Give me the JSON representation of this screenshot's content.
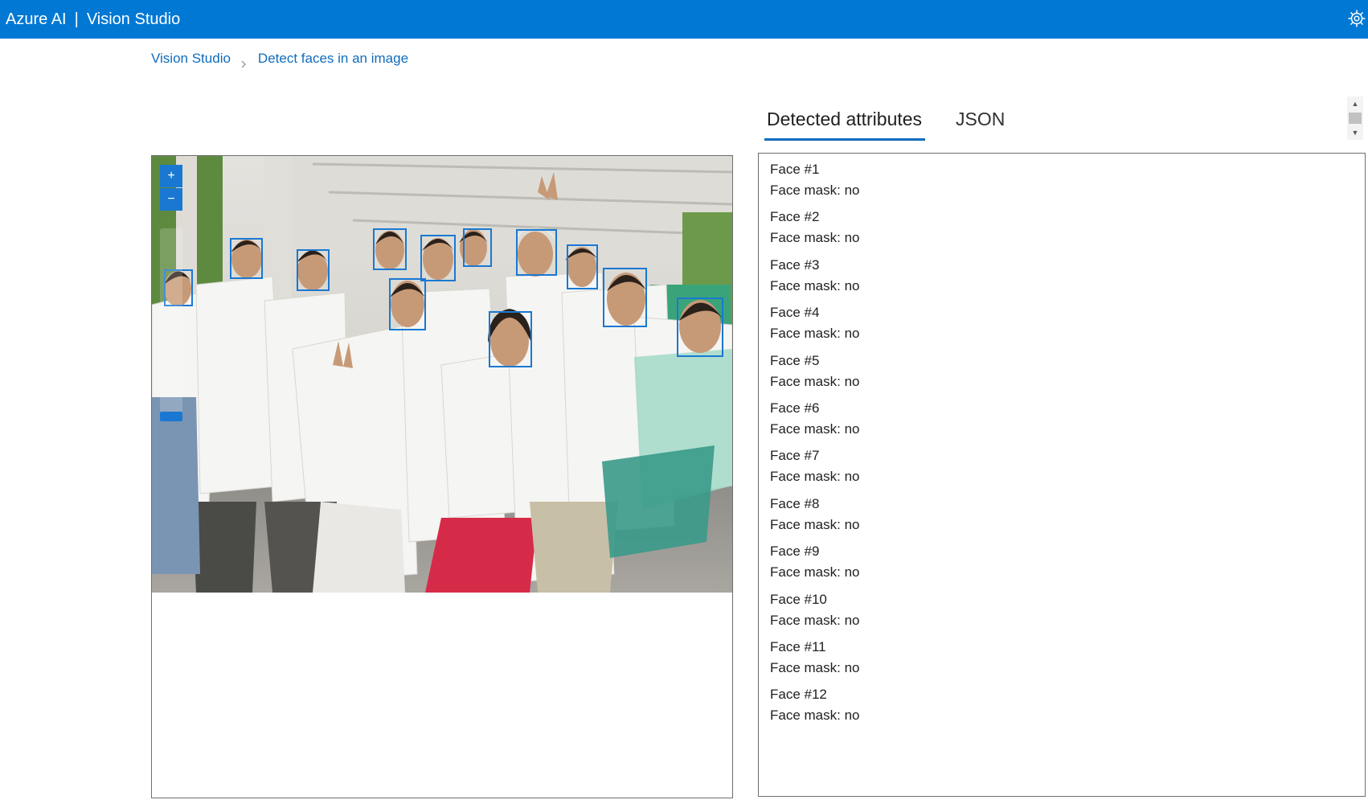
{
  "header": {
    "brand": "Azure AI",
    "separator": "|",
    "app_name": "Vision Studio",
    "settings_icon": "gear-icon"
  },
  "breadcrumb": {
    "home": "Vision Studio",
    "current": "Detect faces in an image"
  },
  "image_viewer": {
    "zoom_in_label": "+",
    "zoom_out_label": "−",
    "zoom_level": 0.05,
    "face_box_color": "#1a78d2",
    "description": "Group photo of twelve young people in white T-shirts posing in a covered outdoor corridor; each detected face is outlined with a blue rectangle."
  },
  "tabs": [
    {
      "label": "Detected attributes",
      "active": true
    },
    {
      "label": "JSON",
      "active": false
    }
  ],
  "faces": [
    {
      "title": "Face #1",
      "mask": "Face mask: no"
    },
    {
      "title": "Face #2",
      "mask": "Face mask: no"
    },
    {
      "title": "Face #3",
      "mask": "Face mask: no"
    },
    {
      "title": "Face #4",
      "mask": "Face mask: no"
    },
    {
      "title": "Face #5",
      "mask": "Face mask: no"
    },
    {
      "title": "Face #6",
      "mask": "Face mask: no"
    },
    {
      "title": "Face #7",
      "mask": "Face mask: no"
    },
    {
      "title": "Face #8",
      "mask": "Face mask: no"
    },
    {
      "title": "Face #9",
      "mask": "Face mask: no"
    },
    {
      "title": "Face #10",
      "mask": "Face mask: no"
    },
    {
      "title": "Face #11",
      "mask": "Face mask: no"
    },
    {
      "title": "Face #12",
      "mask": "Face mask: no"
    }
  ],
  "colors": {
    "header_bg": "#0078d4",
    "link": "#0f6cbd",
    "tab_underline": "#0f6cbd",
    "panel_border": "#6e6e6e"
  }
}
